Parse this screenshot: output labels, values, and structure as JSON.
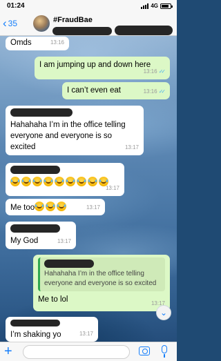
{
  "status_bar": {
    "time": "01:24",
    "network": "4G",
    "battery_level": 0.8
  },
  "header": {
    "back_count": "35",
    "chat_name": "#FraudBae"
  },
  "messages": [
    {
      "direction": "in",
      "text": "Omds",
      "time": "13:16"
    },
    {
      "direction": "out",
      "text": "I am jumping up and down here",
      "time": "13:16",
      "read": true
    },
    {
      "direction": "out",
      "text": "I can’t even eat",
      "time": "13:16",
      "read": true
    },
    {
      "direction": "in",
      "text": "Hahahaha I’m in the office telling everyone and everyone is so excited",
      "time": "13:17",
      "sender_redacted": true
    },
    {
      "direction": "in",
      "text": "",
      "emoji_count": 9,
      "emoji": "face-with-tears-of-joy",
      "time": "13:17",
      "sender_redacted": true
    },
    {
      "direction": "in",
      "text": "Me too",
      "emoji_count": 3,
      "emoji": "face-with-tears-of-joy",
      "time": "13:17"
    },
    {
      "direction": "in",
      "text": "My God",
      "time": "13:17",
      "sender_redacted": true
    },
    {
      "direction": "out",
      "quote_text": "Hahahaha I’m in the office telling everyone and everyone is so excited",
      "text": "Me to lol",
      "time": "13:17"
    },
    {
      "direction": "in",
      "text": "I’m shaking yo",
      "time": "13:17",
      "sender_redacted": true
    }
  ],
  "input": {
    "placeholder": ""
  },
  "colors": {
    "accent": "#147efb",
    "outgoing_bubble": "#dcf8c6",
    "incoming_bubble": "#ffffff",
    "read_ticks": "#4fb6ec"
  }
}
